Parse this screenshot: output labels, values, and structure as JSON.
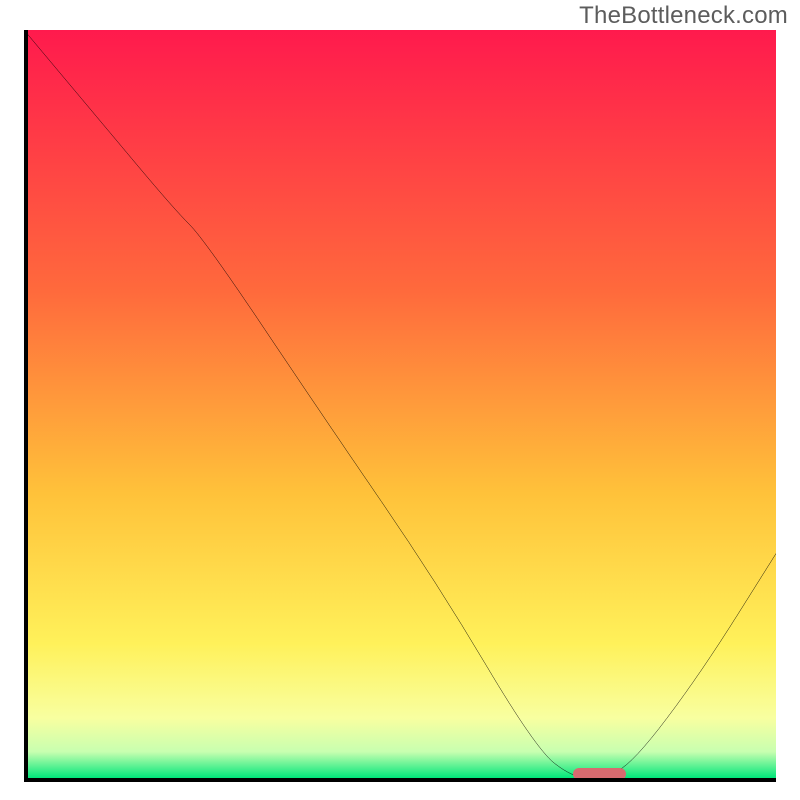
{
  "watermark": "TheBottleneck.com",
  "chart_data": {
    "type": "line",
    "title": "",
    "xlabel": "",
    "ylabel": "",
    "xlim": [
      0,
      100
    ],
    "ylim": [
      0,
      100
    ],
    "grid": false,
    "legend": false,
    "gradient_stops": [
      {
        "offset": 0.0,
        "color": "#ff1a4d"
      },
      {
        "offset": 0.35,
        "color": "#ff6a3c"
      },
      {
        "offset": 0.62,
        "color": "#ffc23a"
      },
      {
        "offset": 0.82,
        "color": "#fff15a"
      },
      {
        "offset": 0.92,
        "color": "#f8ffa0"
      },
      {
        "offset": 0.965,
        "color": "#c8ffb0"
      },
      {
        "offset": 1.0,
        "color": "#00e67a"
      }
    ],
    "series": [
      {
        "name": "bottleneck-curve",
        "color": "#000000",
        "x": [
          0,
          10,
          20,
          24,
          40,
          55,
          68,
          73,
          77,
          81,
          90,
          100
        ],
        "y": [
          100,
          88,
          76,
          72,
          48,
          26,
          4,
          0,
          0,
          2,
          14,
          30
        ]
      }
    ],
    "marker": {
      "name": "optimal-range",
      "color": "#d76a6f",
      "x_start": 73,
      "x_end": 80,
      "y": 0
    }
  }
}
